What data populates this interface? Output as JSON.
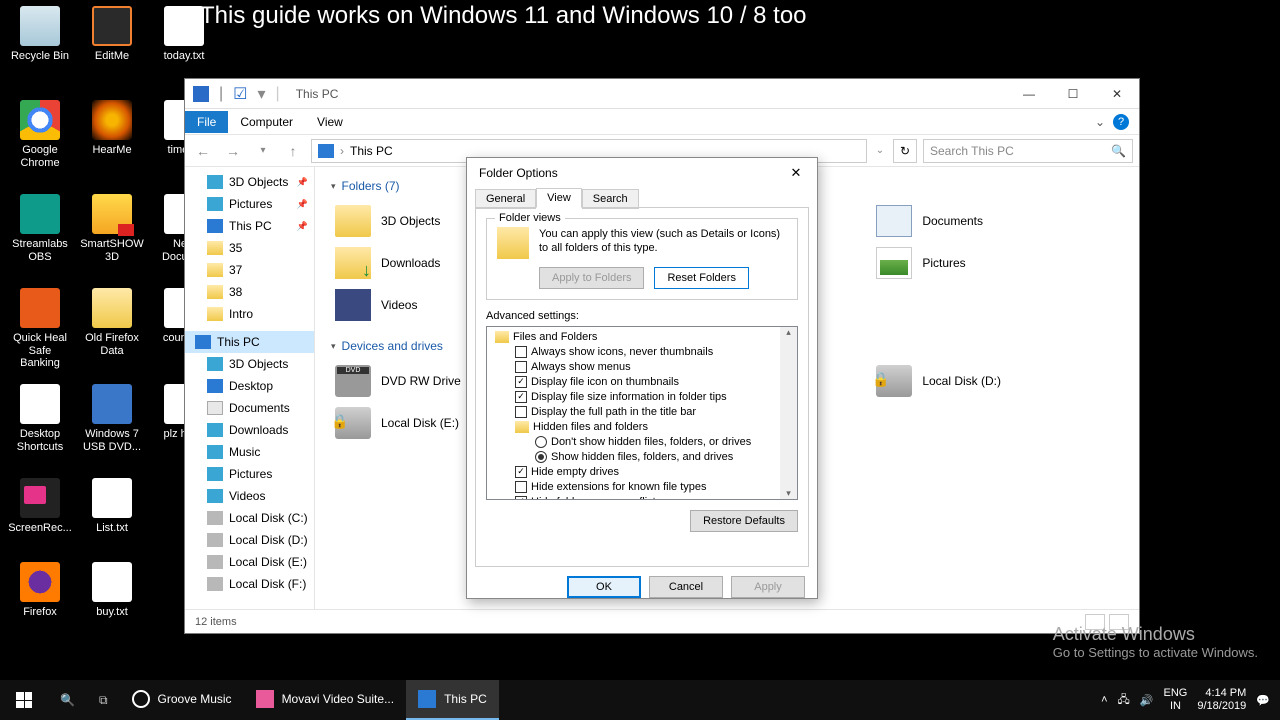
{
  "banner": "This guide works on Windows 11 and Windows 10 / 8 too",
  "desktop_icons": {
    "recycle": "Recycle Bin",
    "editme": "EditMe",
    "today": "today.txt",
    "chrome": "Google Chrome",
    "hearme": "HearMe",
    "timer": "timer...",
    "streamlabs": "Streamlabs OBS",
    "smartshow": "SmartSHOW 3D",
    "newdoc": "New Docum...",
    "quickheal": "Quick Heal Safe Banking",
    "oldfirefox": "Old Firefox Data",
    "countd": "countd...",
    "shortcuts": "Desktop Shortcuts",
    "w7usb": "Windows 7 USB DVD...",
    "plzhid": "plz hid...",
    "screenrec": "ScreenRec...",
    "list": "List.txt",
    "firefox": "Firefox",
    "buy": "buy.txt"
  },
  "explorer": {
    "title": "This PC",
    "menu": {
      "file": "File",
      "computer": "Computer",
      "view": "View"
    },
    "address": "This PC",
    "search_placeholder": "Search This PC",
    "nav": {
      "obj3d": "3D Objects",
      "pictures": "Pictures",
      "thispc": "This PC",
      "n35": "35",
      "n37": "37",
      "n38": "38",
      "intro": "Intro",
      "thispc2": "This PC",
      "obj3d2": "3D Objects",
      "desktop": "Desktop",
      "documents": "Documents",
      "downloads": "Downloads",
      "music": "Music",
      "pictures2": "Pictures",
      "videos": "Videos",
      "ldc": "Local Disk (C:)",
      "ldd": "Local Disk (D:)",
      "lde": "Local Disk (E:)",
      "ldf": "Local Disk (F:)"
    },
    "groups": {
      "folders": "Folders (7)",
      "devices": "Devices and drives"
    },
    "items": {
      "obj3d": "3D Objects",
      "downloads": "Downloads",
      "videos": "Videos",
      "documents": "Documents",
      "pictures": "Pictures",
      "dvd": "DVD RW Drive",
      "lde": "Local Disk (E:)",
      "ldd": "Local Disk (D:)"
    },
    "status": "12 items"
  },
  "dialog": {
    "title": "Folder Options",
    "tabs": {
      "general": "General",
      "view": "View",
      "search": "Search"
    },
    "folder_views": {
      "legend": "Folder views",
      "text": "You can apply this view (such as Details or Icons) to all folders of this type.",
      "apply": "Apply to Folders",
      "reset": "Reset Folders"
    },
    "advanced_label": "Advanced settings:",
    "tree": {
      "root": "Files and Folders",
      "i1": "Always show icons, never thumbnails",
      "i2": "Always show menus",
      "i3": "Display file icon on thumbnails",
      "i4": "Display file size information in folder tips",
      "i5": "Display the full path in the title bar",
      "hidden": "Hidden files and folders",
      "r1": "Don't show hidden files, folders, or drives",
      "r2": "Show hidden files, folders, and drives",
      "i6": "Hide empty drives",
      "i7": "Hide extensions for known file types",
      "i8": "Hide folder merge conflicts"
    },
    "restore": "Restore Defaults",
    "ok": "OK",
    "cancel": "Cancel",
    "apply": "Apply"
  },
  "watermark": {
    "l1": "Activate Windows",
    "l2": "Go to Settings to activate Windows."
  },
  "taskbar": {
    "groove": "Groove Music",
    "movavi": "Movavi Video Suite...",
    "thispc": "This PC",
    "lang": "ENG",
    "kbd": "IN",
    "time": "4:14 PM",
    "date": "9/18/2019"
  }
}
